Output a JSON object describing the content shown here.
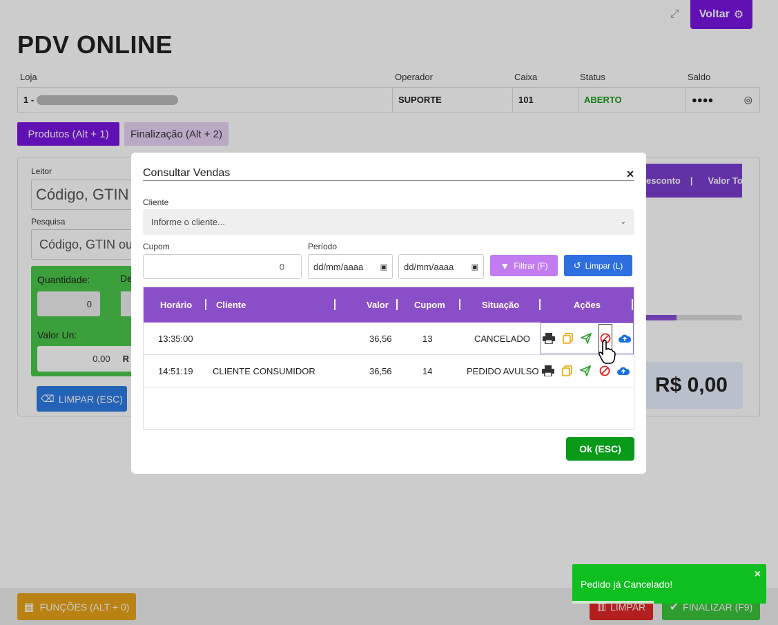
{
  "app": {
    "title": "PDV ONLINE",
    "back_label": "Voltar"
  },
  "header": {
    "labels": {
      "loja": "Loja",
      "operador": "Operador",
      "caixa": "Caixa",
      "status": "Status",
      "saldo": "Saldo"
    },
    "values": {
      "loja": "1 -",
      "operador": "SUPORTE",
      "caixa": "101",
      "status": "ABERTO",
      "saldo": "●●●●"
    }
  },
  "tabs": [
    {
      "label": "Produtos (Alt + 1)"
    },
    {
      "label": "Finalização (Alt + 2)"
    }
  ],
  "form": {
    "leitor_label": "Leitor",
    "leitor_placeholder": "Código, GTIN ou",
    "pesquisa_label": "Pesquisa",
    "pesquisa_placeholder": "Código, GTIN ou",
    "quantidade_label": "Quantidade:",
    "quantidade_value": "0",
    "desconto_label_fragment": "De",
    "valor_un_label": "Valor Un:",
    "valor_un_value": "0,00",
    "valor_un_suffix": "R",
    "limpar_label": "LIMPAR (ESC)"
  },
  "items_table": {
    "header_fragment_1": "esconto",
    "header_fragment_2": "Valor Tot",
    "progress": 0.4,
    "total": "R$ 0,00"
  },
  "footer": {
    "funcoes_label": "FUNÇÕES (ALT + 0)",
    "limpar_label": "LIMPAR",
    "finalizar_label": "FINALIZAR (F9)"
  },
  "modal": {
    "title": "Consultar Vendas",
    "close": "×",
    "cliente_label": "Cliente",
    "cliente_placeholder": "Informe o cliente...",
    "cupom_label": "Cupom",
    "cupom_value": "0",
    "periodo_label": "Período",
    "date_start": "dd/mm/aaaa",
    "date_end": "dd/mm/aaaa",
    "filtrar_label": "Filtrar (F)",
    "limpar_label": "Limpar (L)",
    "columns": {
      "horario": "Horário",
      "cliente": "Cliente",
      "valor": "Valor",
      "cupom": "Cupom",
      "situacao": "Situação",
      "acoes": "Ações"
    },
    "rows": [
      {
        "horario": "13:35:00",
        "cliente": "",
        "valor": "36,56",
        "cupom": "13",
        "situacao": "CANCELADO"
      },
      {
        "horario": "14:51:19",
        "cliente": "CLIENTE CONSUMIDOR",
        "valor": "36,56",
        "cupom": "14",
        "situacao": "PEDIDO AVULSO"
      }
    ],
    "ok_label": "Ok (ESC)"
  },
  "toast": {
    "message": "Pedido já Cancelado!",
    "close": "×"
  },
  "colors": {
    "purple": "#7a14e0",
    "table_header": "#8a4fc8",
    "green": "#0a9a1a",
    "toast": "#0fbf1f"
  }
}
